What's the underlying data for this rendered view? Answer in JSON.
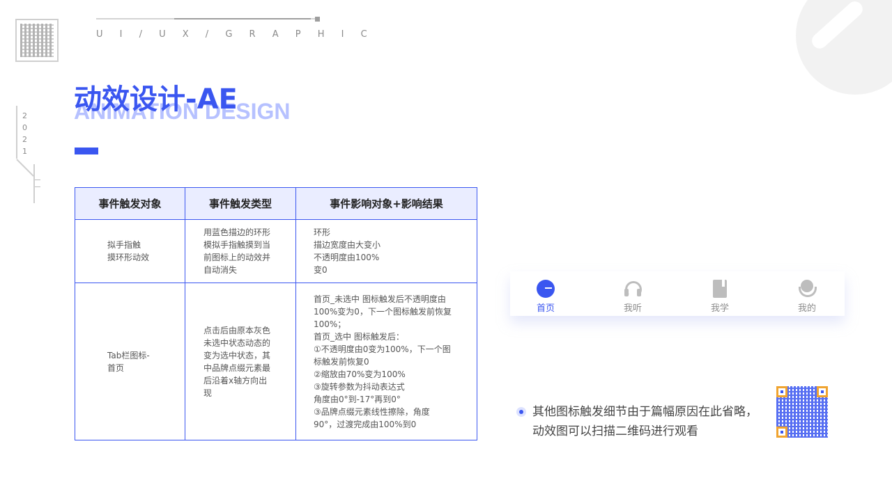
{
  "header": {
    "tagline": "U I / U X / G R A P H I C",
    "year": "2021"
  },
  "title": {
    "main": "动效设计-AE",
    "sub": "ANIMATION DESIGN"
  },
  "table": {
    "headers": [
      "事件触发对象",
      "事件触发类型",
      "事件影响对象+影响结果"
    ],
    "rows": [
      {
        "object": [
          "拟手指触",
          "摸环形动效"
        ],
        "type": [
          "用蓝色描边的环形",
          "模拟手指触摸到当",
          "前图标上的动效并",
          "自动消失"
        ],
        "result": [
          "环形",
          "描边宽度由大变小",
          "不透明度由100%",
          "变0"
        ]
      },
      {
        "object": [
          "Tab栏图标-",
          "首页"
        ],
        "type": [
          "点击后由原本灰色",
          "未选中状态动态的",
          "变为选中状态，其",
          "中品牌点缀元素最",
          "后沿着x轴方向出",
          "现"
        ],
        "result": [
          "首页_未选中 图标触发后不透明度由",
          "100%变为0，下一个图标触发前恢复",
          "100%；",
          "首页_选中 图标触发后：",
          "①不透明度由0变为100%，下一个图",
          "标触发前恢复0",
          "②缩放由70%变为100%",
          "③旋转参数为抖动表达式",
          "角度由0°到-17°再到0°",
          "③品牌点缀元素线性擦除，角度",
          "90°，过渡完成由100%到0"
        ]
      }
    ]
  },
  "tabbar": {
    "items": [
      {
        "label": "首页",
        "icon": "home-icon",
        "active": true
      },
      {
        "label": "我听",
        "icon": "headphones-icon",
        "active": false
      },
      {
        "label": "我学",
        "icon": "book-icon",
        "active": false
      },
      {
        "label": "我的",
        "icon": "profile-icon",
        "active": false
      }
    ],
    "accent": "#3a56f0",
    "inactive_color": "#8c8c8c"
  },
  "note": {
    "text": "其他图标触发细节由于篇幅原因在此省略，动效图可以扫描二维码进行观看"
  },
  "colors": {
    "accent": "#3a56f0",
    "header_bg": "#eaedff"
  }
}
